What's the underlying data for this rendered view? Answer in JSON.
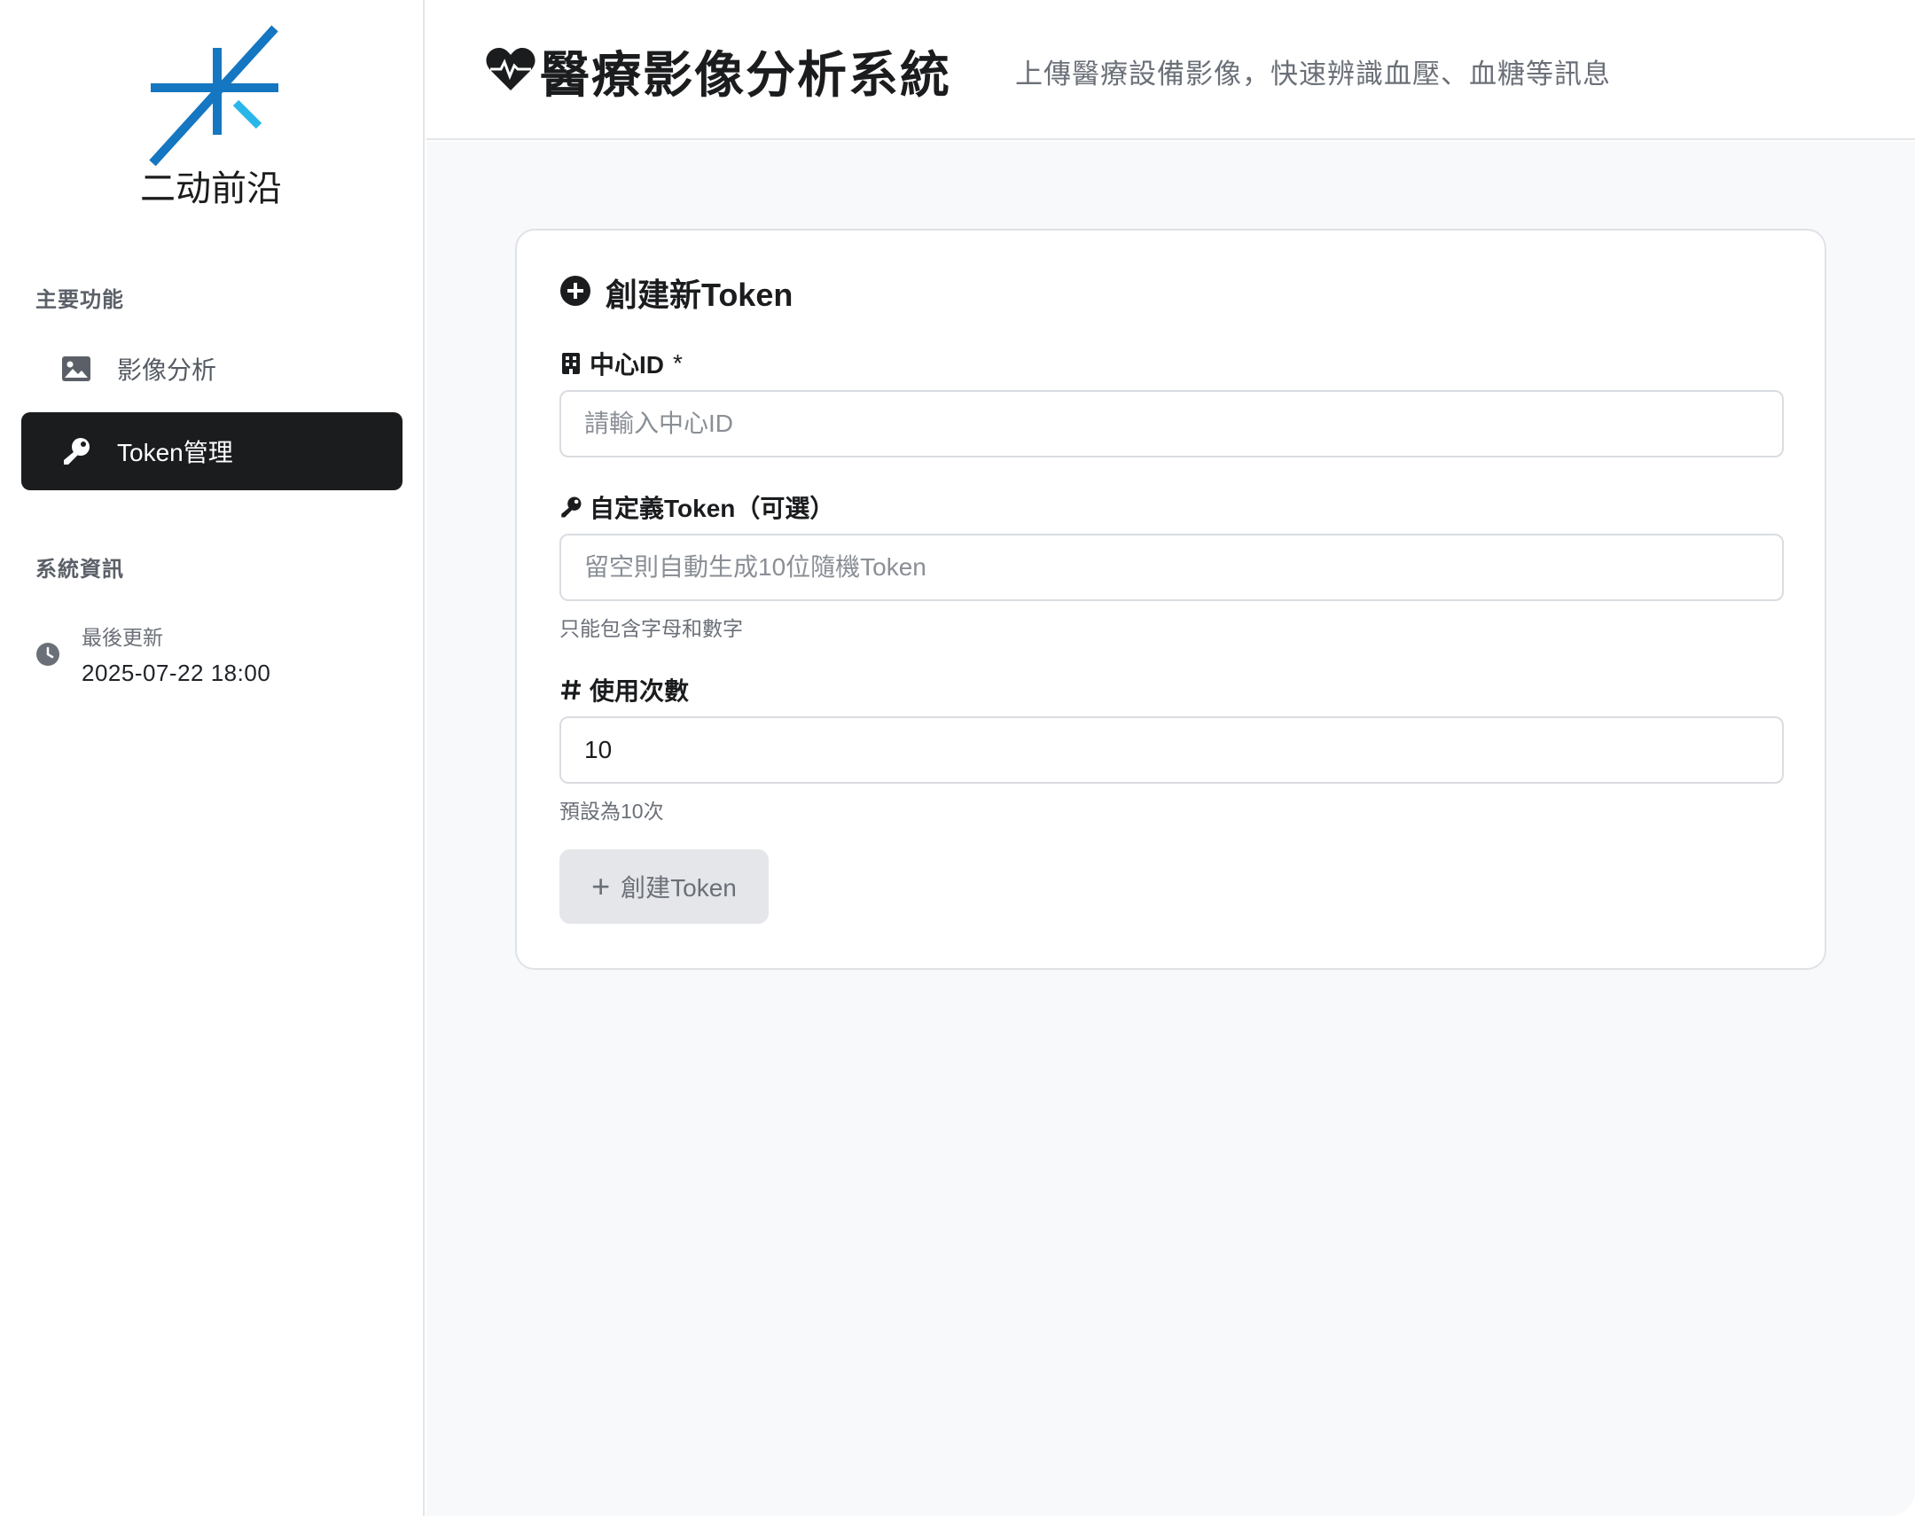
{
  "sidebar": {
    "logo_text": "二动前沿",
    "sections": {
      "main_title": "主要功能",
      "info_title": "系統資訊"
    },
    "items": [
      {
        "label": "影像分析",
        "icon": "image-icon",
        "active": false
      },
      {
        "label": "Token管理",
        "icon": "key-icon",
        "active": true
      }
    ],
    "info": {
      "label": "最後更新",
      "value": "2025-07-22 18:00",
      "icon": "clock-icon"
    }
  },
  "header": {
    "title": "醫療影像分析系統",
    "subtitle": "上傳醫療設備影像，快速辨識血壓、血糖等訊息",
    "icon": "heart-pulse-icon"
  },
  "card": {
    "title": "創建新Token",
    "icon": "plus-circle-icon",
    "fields": {
      "center_id": {
        "label": "中心ID",
        "required_mark": "*",
        "placeholder": "請輸入中心ID",
        "value": "",
        "icon": "building-icon"
      },
      "custom_token": {
        "label": "自定義Token（可選）",
        "placeholder": "留空則自動生成10位隨機Token",
        "value": "",
        "help": "只能包含字母和數字",
        "icon": "key-icon"
      },
      "usage_count": {
        "label": "使用次數",
        "value": "10",
        "help": "預設為10次",
        "icon": "hash-icon"
      }
    },
    "submit_label": "創建Token"
  },
  "colors": {
    "active_nav_bg": "#1b1c1e",
    "main_bg": "#f8f9fb",
    "logo_blue": "#1576c1",
    "logo_cyan": "#29b6e8"
  }
}
